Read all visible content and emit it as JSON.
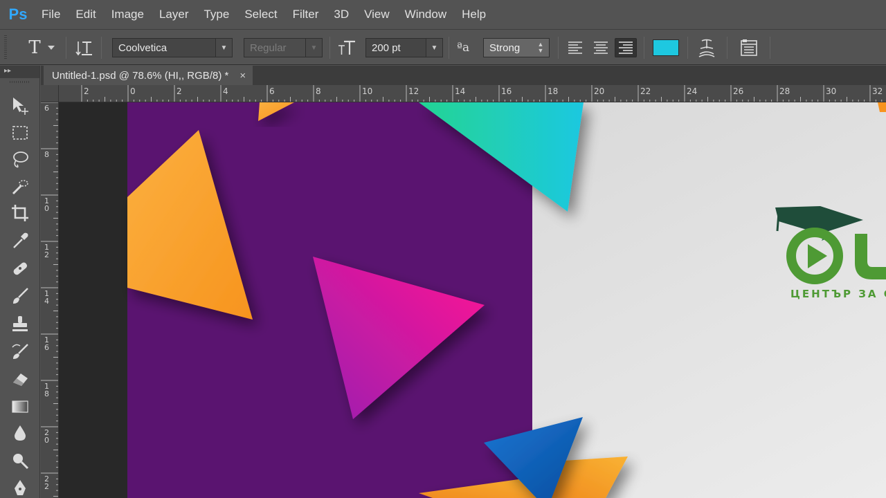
{
  "app": {
    "logo": "Ps"
  },
  "menu": [
    "File",
    "Edit",
    "Image",
    "Layer",
    "Type",
    "Select",
    "Filter",
    "3D",
    "View",
    "Window",
    "Help"
  ],
  "options": {
    "tool_icon": "T",
    "font_family": "Coolvetica",
    "font_style": "Regular",
    "font_size": "200 pt",
    "antialias_label": "ªa",
    "antialias": "Strong",
    "text_color": "#1ec8e0"
  },
  "toolbar": {
    "collapse_glyph": "▸▸",
    "tools": [
      "move-tool",
      "marquee-tool",
      "lasso-tool",
      "quick-selection-tool",
      "crop-tool",
      "eyedropper-tool",
      "healing-brush-tool",
      "brush-tool",
      "clone-stamp-tool",
      "history-brush-tool",
      "eraser-tool",
      "gradient-tool",
      "blur-tool",
      "dodge-tool",
      "pen-tool"
    ]
  },
  "document": {
    "tab_title": "Untitled-1.psd @ 78.6% (HI,, RGB/8) *",
    "close_glyph": "×"
  },
  "rulers": {
    "horizontal": [
      "2",
      "0",
      "2",
      "4",
      "6",
      "8",
      "10",
      "12",
      "14",
      "16",
      "18",
      "20",
      "22",
      "24",
      "26",
      "28",
      "30",
      "32"
    ],
    "vertical": [
      "6",
      "8",
      "10",
      "12",
      "14",
      "16",
      "18",
      "20",
      "22"
    ]
  },
  "artwork": {
    "logo_caption": "ЦЕНТЪР ЗА С",
    "colors": {
      "purple": "#5a1470",
      "light_bg": "#e6e6e6",
      "orange": "#f7931e",
      "teal": "#1ec8e0",
      "magenta": "#e0169a",
      "blue": "#0a5fc0",
      "logo_green": "#4e9a34",
      "logo_dark": "#1f4d3a"
    }
  }
}
